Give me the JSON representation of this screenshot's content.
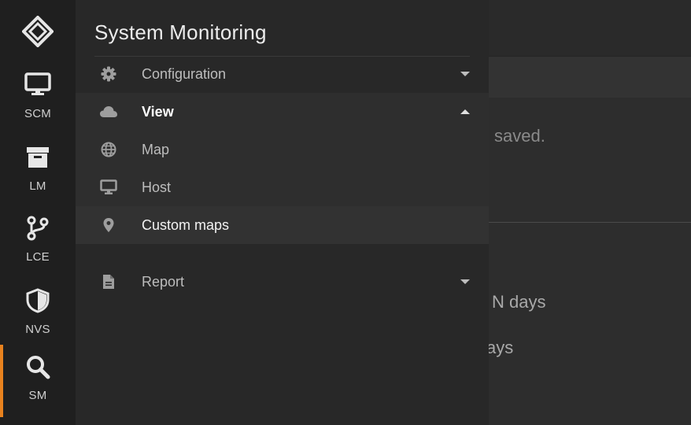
{
  "rail": {
    "items": [
      {
        "label": "SCM",
        "icon": "monitor-icon"
      },
      {
        "label": "LM",
        "icon": "archive-icon"
      },
      {
        "label": "LCE",
        "icon": "branch-icon"
      },
      {
        "label": "NVS",
        "icon": "shield-icon"
      },
      {
        "label": "SM",
        "icon": "search-icon",
        "active": true
      }
    ],
    "accent_color": "#e8821e"
  },
  "drawer": {
    "title": "System Monitoring",
    "menu": [
      {
        "label": "Configuration",
        "icon": "gear-icon",
        "chevron": "down"
      },
      {
        "label": "View",
        "icon": "cloud-icon",
        "chevron": "up",
        "expanded": true
      },
      {
        "label": "Map",
        "icon": "globe-icon"
      },
      {
        "label": "Host",
        "icon": "monitor-icon"
      },
      {
        "label": "Custom maps",
        "icon": "location-pin-icon",
        "selected": true
      },
      {
        "label": "Report",
        "icon": "document-icon",
        "chevron": "down"
      }
    ]
  },
  "background": {
    "text1": "saved.",
    "text2": "N days",
    "text3": "ays"
  }
}
